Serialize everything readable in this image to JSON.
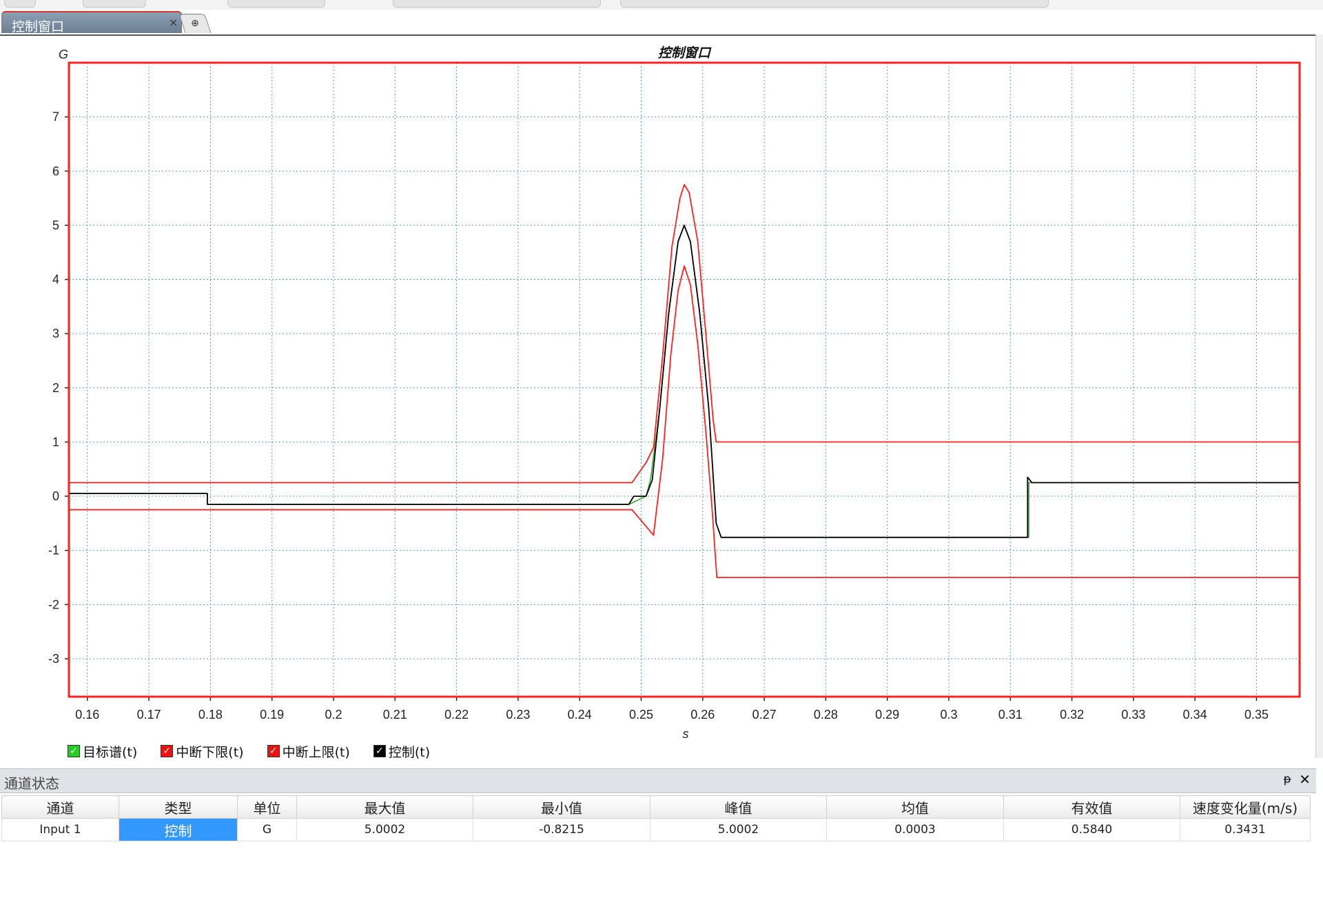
{
  "tab": {
    "title": "控制窗口",
    "close_icon": "×",
    "new_icon": "⊕"
  },
  "chart_data": {
    "type": "line",
    "title": "控制窗口",
    "xlabel": "s",
    "ylabel": "G",
    "xlim": [
      0.157,
      0.357
    ],
    "ylim": [
      -3.7,
      8.0
    ],
    "grid": true,
    "x_ticks": [
      0.16,
      0.17,
      0.18,
      0.19,
      0.2,
      0.21,
      0.22,
      0.23,
      0.24,
      0.25,
      0.26,
      0.27,
      0.28,
      0.29,
      0.3,
      0.31,
      0.32,
      0.33,
      0.34,
      0.35
    ],
    "x_tick_labels": [
      "0.16",
      "0.17",
      "0.18",
      "0.19",
      "0.2",
      "0.21",
      "0.22",
      "0.23",
      "0.24",
      "0.25",
      "0.26",
      "0.27",
      "0.28",
      "0.29",
      "0.3",
      "0.31",
      "0.32",
      "0.33",
      "0.34",
      "0.35"
    ],
    "y_ticks": [
      7,
      6,
      5,
      4,
      3,
      2,
      1,
      0,
      -1,
      -2,
      -3
    ],
    "y_tick_labels": [
      "7",
      "6",
      "5",
      "4",
      "3",
      "2",
      "1",
      "0",
      "-1",
      "-2",
      "-3"
    ],
    "series": [
      {
        "name": "目标谱(t)",
        "color": "#22aa22",
        "width": 1.5,
        "x": [
          0.157,
          0.1795,
          0.1795,
          0.248,
          0.2508,
          0.2515,
          0.253,
          0.2545,
          0.256,
          0.257,
          0.258,
          0.2595,
          0.261,
          0.2622,
          0.263,
          0.313,
          0.313,
          0.357
        ],
        "y": [
          0.05,
          0.05,
          -0.15,
          -0.15,
          0.0,
          0.3,
          1.6,
          3.4,
          4.7,
          5.0,
          4.7,
          3.4,
          1.6,
          -0.5,
          -0.76,
          -0.76,
          0.25,
          0.25
        ]
      },
      {
        "name": "中断下限(t)",
        "color": "#ff2020",
        "width": 1.8,
        "x": [
          0.157,
          0.2485,
          0.252,
          0.2535,
          0.2548,
          0.256,
          0.257,
          0.258,
          0.2592,
          0.2605,
          0.2615,
          0.2623,
          0.2623,
          0.357
        ],
        "y": [
          -0.25,
          -0.25,
          -0.72,
          0.7,
          2.6,
          3.8,
          4.25,
          3.9,
          2.8,
          1.2,
          -0.2,
          -1.5,
          -1.5,
          -1.5
        ]
      },
      {
        "name": "中断上限(t)",
        "color": "#ff2020",
        "width": 1.8,
        "x": [
          0.157,
          0.2485,
          0.2508,
          0.252,
          0.2535,
          0.255,
          0.2563,
          0.257,
          0.2578,
          0.2592,
          0.2605,
          0.2617,
          0.2622,
          0.2622,
          0.357
        ],
        "y": [
          0.25,
          0.25,
          0.62,
          0.9,
          2.6,
          4.6,
          5.5,
          5.75,
          5.6,
          4.7,
          3.0,
          1.4,
          1.0,
          1.0,
          1.0
        ]
      },
      {
        "name": "控制(t)",
        "color": "#000000",
        "width": 1.8,
        "x": [
          0.157,
          0.1795,
          0.1795,
          0.248,
          0.2488,
          0.2508,
          0.2518,
          0.253,
          0.2545,
          0.256,
          0.257,
          0.258,
          0.2595,
          0.261,
          0.2622,
          0.263,
          0.3128,
          0.3128,
          0.3135,
          0.357
        ],
        "y": [
          0.05,
          0.05,
          -0.15,
          -0.15,
          0.0,
          0.0,
          0.3,
          1.6,
          3.4,
          4.7,
          5.0,
          4.7,
          3.4,
          1.6,
          -0.5,
          -0.76,
          -0.76,
          0.35,
          0.25,
          0.25
        ]
      }
    ]
  },
  "legend": [
    {
      "label": "目标谱(t)",
      "color": "#22cc22",
      "check": "✓"
    },
    {
      "label": "中断下限(t)",
      "color": "#ee1111",
      "check": "✓"
    },
    {
      "label": "中断上限(t)",
      "color": "#ee1111",
      "check": "✓"
    },
    {
      "label": "控制(t)",
      "color": "#000000",
      "check": "✓"
    }
  ],
  "panel": {
    "title": "通道状态",
    "pin_icon": "ᵽ",
    "close_icon": "✕",
    "columns": [
      "通道",
      "类型",
      "单位",
      "最大值",
      "最小值",
      "峰值",
      "均值",
      "有效值",
      "速度变化量(m/s)"
    ],
    "rows": [
      [
        "Input 1",
        "控制",
        "G",
        "5.0002",
        "-0.8215",
        "5.0002",
        "0.0003",
        "0.5840",
        "0.3431"
      ]
    ]
  }
}
